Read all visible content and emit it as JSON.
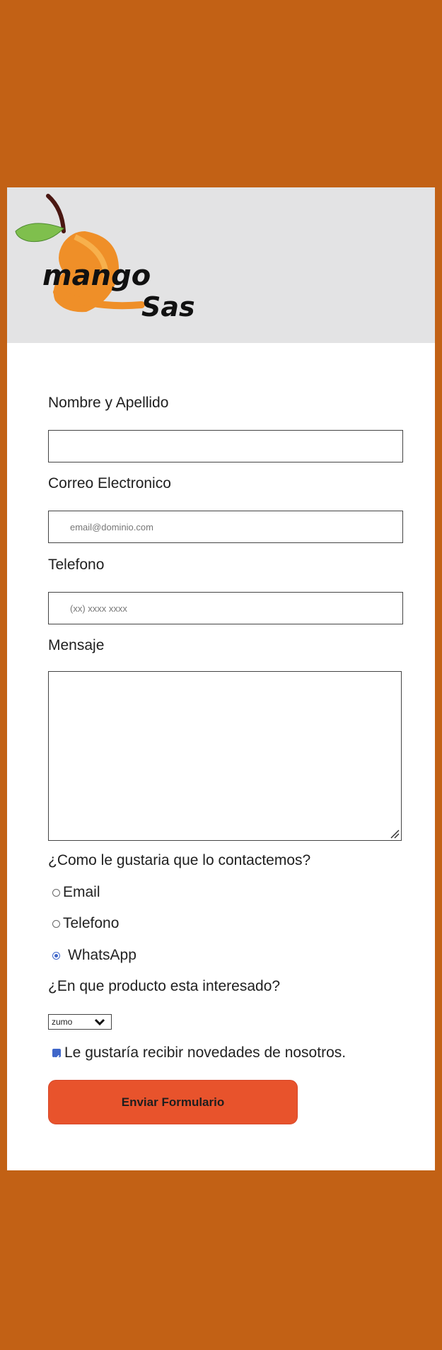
{
  "brand": {
    "logo_word1": "mango",
    "logo_word2": "Sas"
  },
  "form": {
    "name_label": "Nombre y Apellido",
    "email_label": "Correo Electronico",
    "email_placeholder": "email@dominio.com",
    "phone_label": "Telefono",
    "phone_placeholder": "(xx) xxxx xxxx",
    "message_label": "Mensaje",
    "contact_question": "¿Como le gustaria que lo contactemos?",
    "contact_options": [
      "Email",
      "Telefono",
      "WhatsApp"
    ],
    "contact_selected": "WhatsApp",
    "product_question": "¿En que producto esta interesado?",
    "product_selected": "zumo",
    "newsletter_label": "Le gustaría recibir novedades de nosotros.",
    "newsletter_checked": true,
    "submit_label": "Enviar Formulario"
  },
  "colors": {
    "page_background": "#c26115",
    "header_background": "#e3e3e4",
    "button": "#e8532c",
    "accent": "#3f66c9"
  }
}
